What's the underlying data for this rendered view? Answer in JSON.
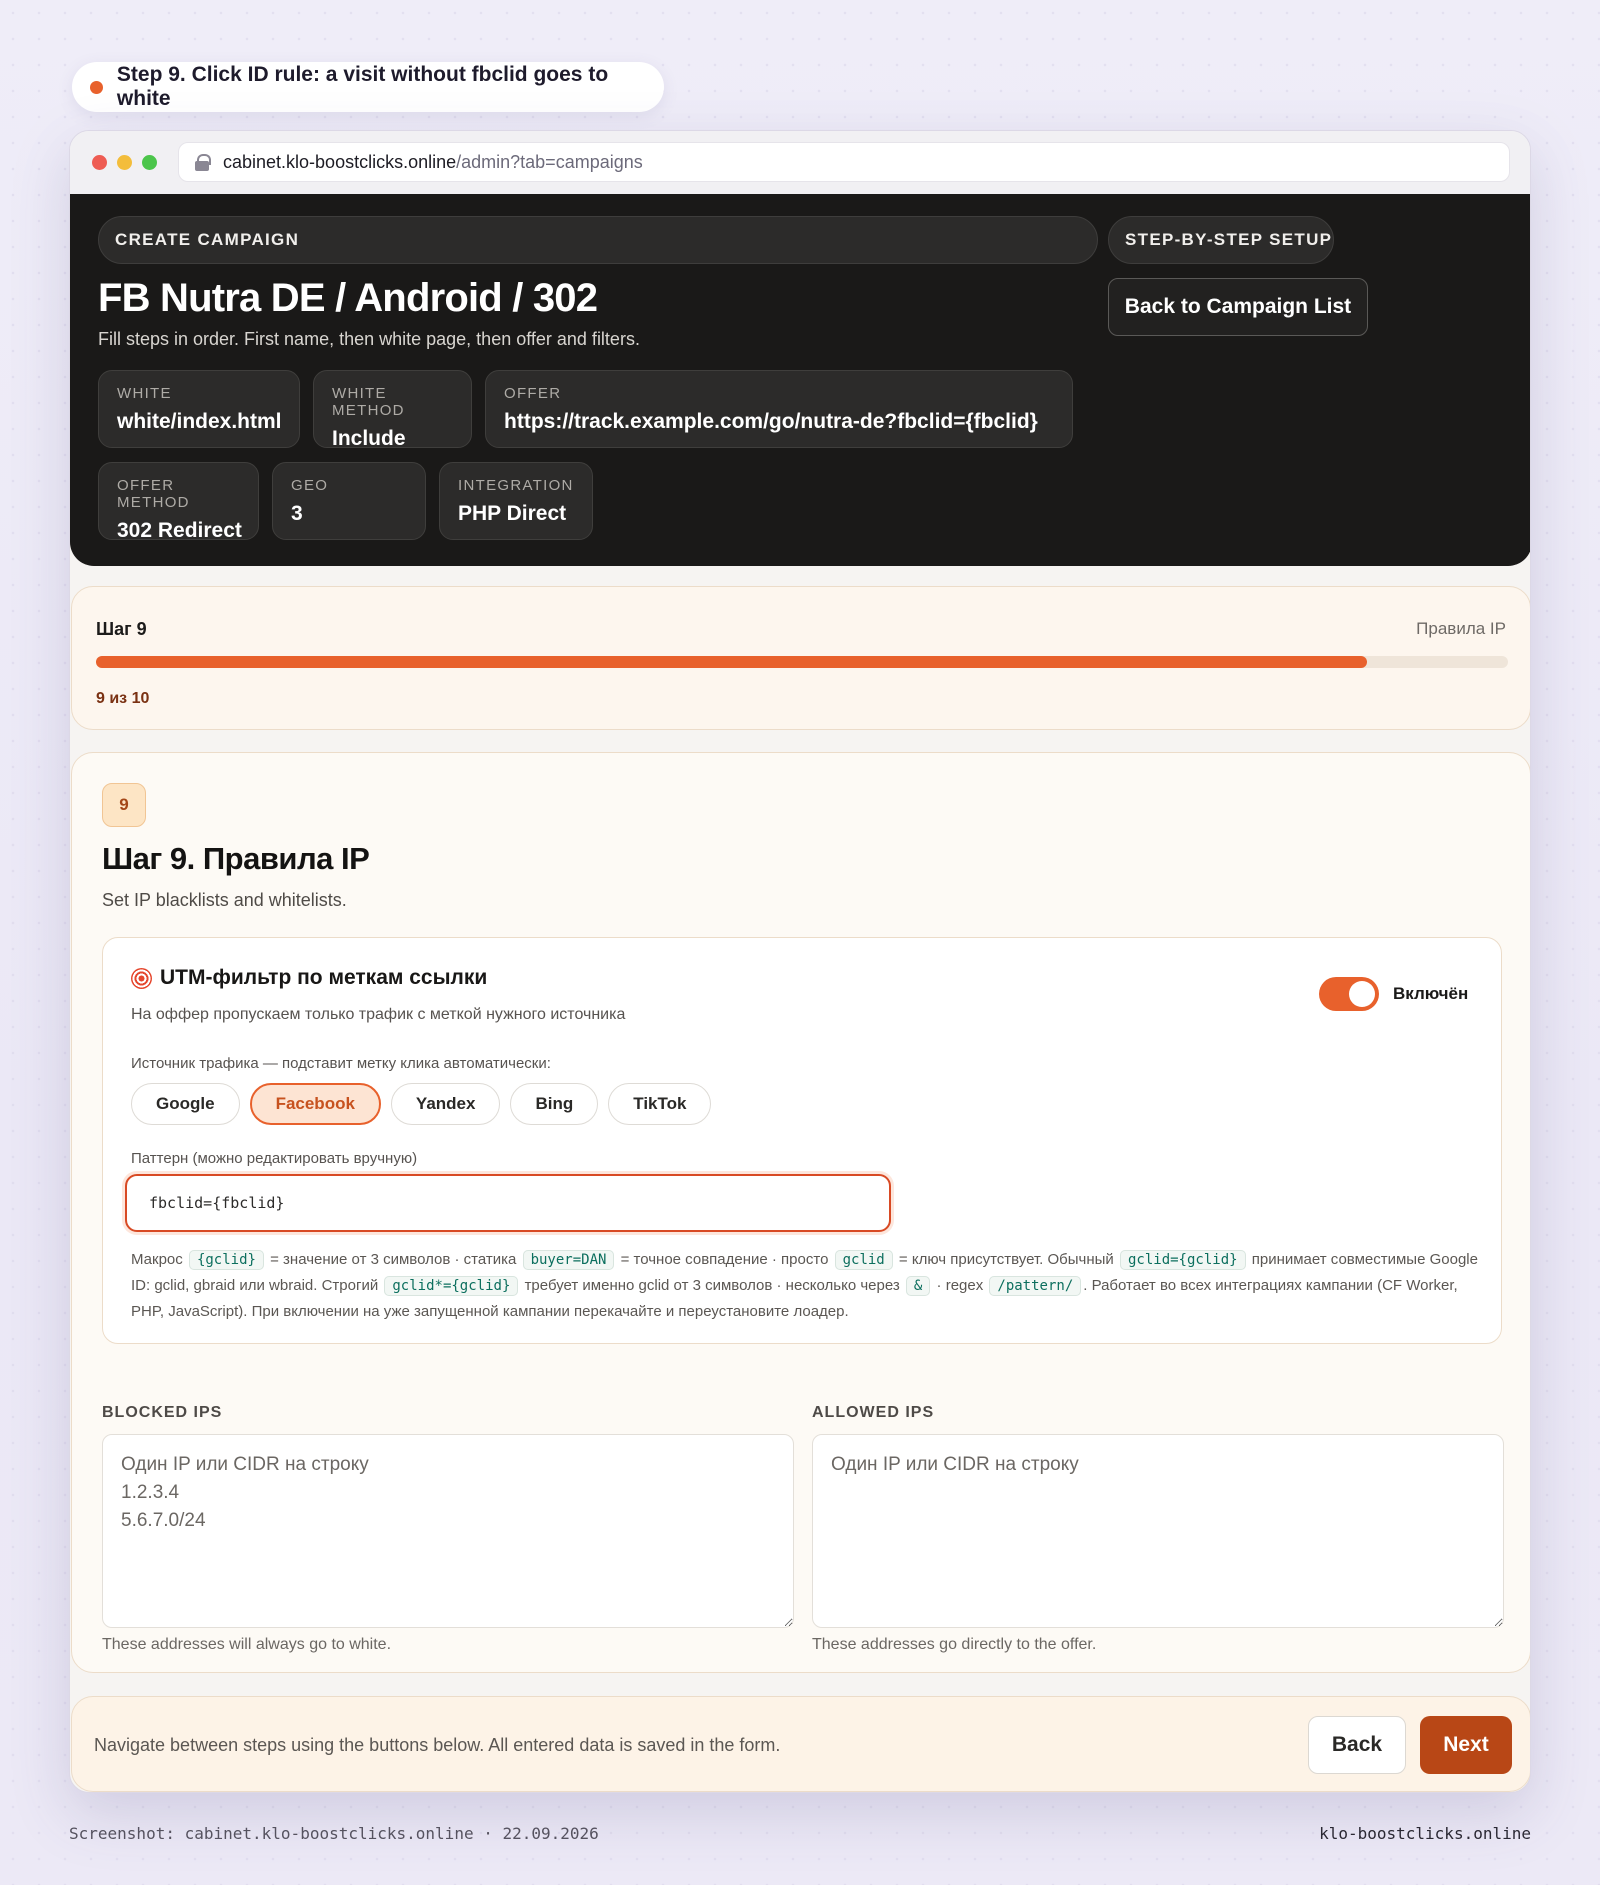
{
  "banner": {
    "text": "Step 9. Click ID rule: a visit without fbclid goes to white"
  },
  "browser": {
    "url_host": "cabinet.klo-boostclicks.online",
    "url_path": "/admin?tab=campaigns"
  },
  "hero": {
    "tag_create": "CREATE CAMPAIGN",
    "tag_setup": "STEP-BY-STEP SETUP",
    "title": "FB Nutra DE / Android / 302",
    "subtitle": "Fill steps in order. First name, then white page, then offer and filters.",
    "back_button": "Back to Campaign List",
    "info": {
      "white_label": "WHITE",
      "white_value": "white/index.html",
      "white_method_label": "WHITE METHOD",
      "white_method_value": "Include",
      "offer_label": "OFFER",
      "offer_value": "https://track.example.com/go/nutra-de?fbclid={fbclid}",
      "offer_method_label": "OFFER METHOD",
      "offer_method_value": "302 Redirect",
      "geo_label": "GEO",
      "geo_value": "3",
      "integration_label": "INTEGRATION",
      "integration_value": "PHP Direct"
    }
  },
  "progress": {
    "step_label": "Шаг 9",
    "step_name": "Правила IP",
    "count": "9 из 10",
    "fraction": 0.9
  },
  "step": {
    "number": "9",
    "title": "Шаг 9. Правила IP",
    "subtitle": "Set IP blacklists and whitelists."
  },
  "utm": {
    "title": "UTM-фильтр по меткам ссылки",
    "icon": "target-icon",
    "description": "На оффер пропускаем только трафик с меткой нужного источника",
    "toggle_label": "Включён",
    "toggle_on": true,
    "source_label": "Источник трафика — подставит метку клика автоматически:",
    "sources": [
      "Google",
      "Facebook",
      "Yandex",
      "Bing",
      "TikTok"
    ],
    "active_source": "Facebook",
    "pattern_label": "Паттерн (можно редактировать вручную)",
    "pattern_value": "fbclid={fbclid}",
    "help": {
      "p1": "Макрос",
      "c1": "{gclid}",
      "p2": "= значение от 3 символов · статика",
      "c2": "buyer=DAN",
      "p3": "= точное совпадение · просто",
      "c3": "gclid",
      "p4": "= ключ присутствует. Обычный",
      "c4": "gclid={gclid}",
      "p5": "принимает совместимые Google ID: gclid, gbraid или wbraid. Строгий",
      "c5": "gclid*={gclid}",
      "p6": "требует именно gclid от 3 символов · несколько через",
      "c6": "&",
      "p7": "· regex",
      "c7": "/pattern/",
      "p8": ". Работает во всех интеграциях кампании (CF Worker, PHP, JavaScript). При включении на уже запущенной кампании перекачайте и переустановите лоадер."
    }
  },
  "ips": {
    "blocked_label": "BLOCKED IPS",
    "blocked_placeholder": "Один IP или CIDR на строку\n1.2.3.4\n5.6.7.0/24",
    "blocked_hint": "These addresses will always go to white.",
    "allowed_label": "ALLOWED IPS",
    "allowed_placeholder": "Один IP или CIDR на строку",
    "allowed_hint": "These addresses go directly to the offer."
  },
  "footer": {
    "text": "Navigate between steps using the buttons below. All entered data is saved in the form.",
    "back": "Back",
    "next": "Next"
  },
  "caption": {
    "left": "Screenshot: cabinet.klo-boostclicks.online · 22.09.2026",
    "right": "klo-boostclicks.online"
  },
  "colors": {
    "accent": "#e8612c",
    "dark": "#1a1918",
    "next_button": "#b84716"
  }
}
